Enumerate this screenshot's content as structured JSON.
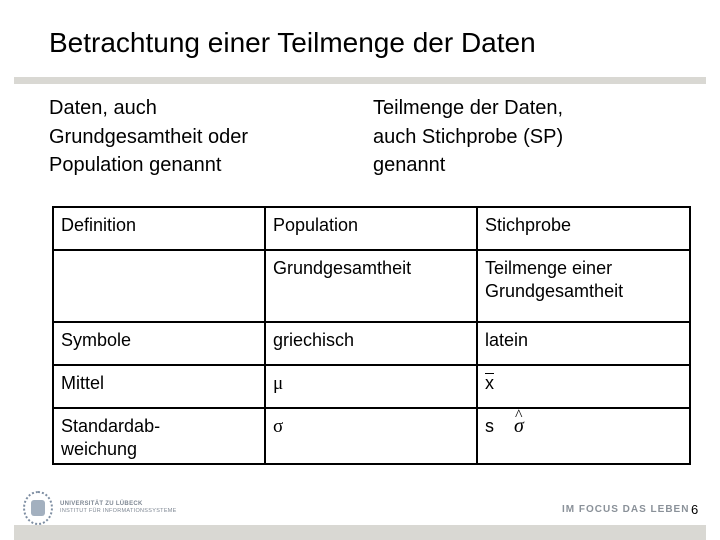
{
  "slide": {
    "title": "Betrachtung einer Teilmenge der Daten",
    "intro_left": "Daten, auch\nGrundgesamtheit oder\nPopulation genannt",
    "intro_right": "Teilmenge der Daten,\nauch Stichprobe (SP)\ngenannt"
  },
  "table": {
    "rows": [
      [
        "Definition",
        "Population",
        "Stichprobe"
      ],
      [
        "",
        "Grundgesamtheit",
        "Teilmenge einer\nGrundgesamtheit"
      ],
      [
        "Symbole",
        "griechisch",
        "latein"
      ],
      [
        "Mittel",
        "μ",
        "x"
      ],
      [
        "Standardab-\nweichung",
        "σ",
        "s"
      ]
    ],
    "sigma_hat": "σ",
    "hat_glyph": "^"
  },
  "footer": {
    "university": "UNIVERSITÄT ZU LÜBECK",
    "institute": "INSTITUT FÜR INFORMATIONSSYSTEME",
    "slogan": "IM FOCUS DAS LEBEN",
    "page_number": "6"
  }
}
